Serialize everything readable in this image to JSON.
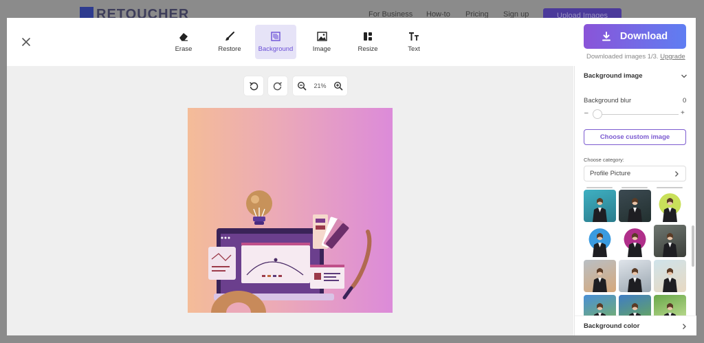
{
  "site": {
    "logo": "RETOUCHER",
    "nav": [
      "For Business",
      "How-to",
      "Pricing",
      "Sign up"
    ],
    "upload_label": "Upload Images"
  },
  "toolbar": {
    "tools": [
      {
        "label": "Erase",
        "icon": "eraser-icon"
      },
      {
        "label": "Restore",
        "icon": "brush-icon"
      },
      {
        "label": "Background",
        "icon": "background-icon",
        "active": true
      },
      {
        "label": "Image",
        "icon": "image-icon"
      },
      {
        "label": "Resize",
        "icon": "resize-layout-icon"
      },
      {
        "label": "Text",
        "icon": "text-icon"
      }
    ]
  },
  "download": {
    "label": "Download",
    "info": "Downloaded images 1/3.",
    "upgrade": "Upgrade"
  },
  "canvas": {
    "zoom": "21%"
  },
  "panel": {
    "bg_image_title": "Background image",
    "blur_label": "Background blur",
    "blur_value": "0",
    "blur_minus": "–",
    "blur_plus": "+",
    "custom_image_label": "Choose custom image",
    "category_label": "Choose category:",
    "category_value": "Profile Picture",
    "bg_color_title": "Background color"
  },
  "colors": {
    "accent": "#7b5ad0",
    "download_start": "#8a54d8",
    "download_end": "#5f7ef2"
  }
}
